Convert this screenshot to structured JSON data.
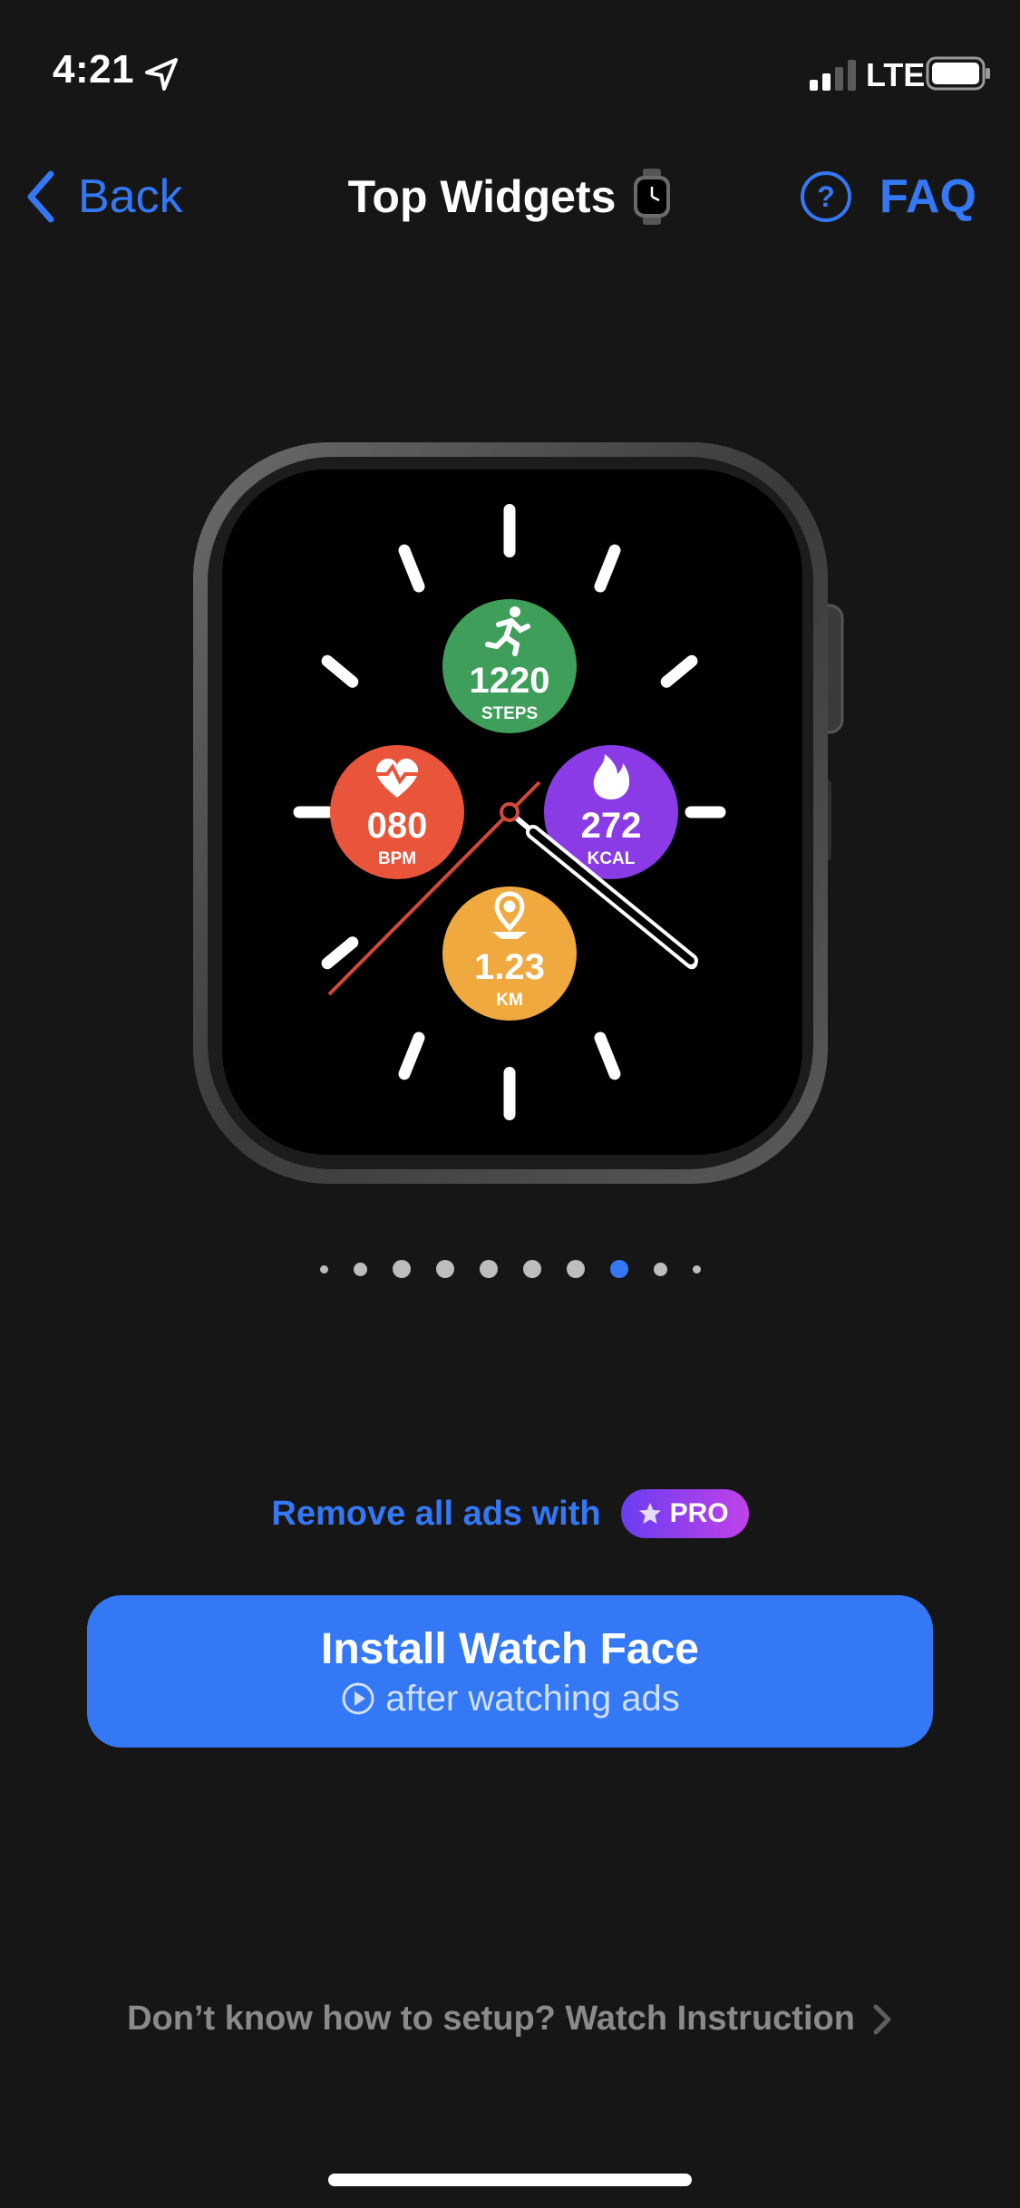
{
  "status_bar": {
    "time": "4:21",
    "network": "LTE"
  },
  "nav": {
    "back_label": "Back",
    "title": "Top Widgets",
    "faq_label": "FAQ"
  },
  "watch_face": {
    "steps": {
      "value": "1220",
      "unit": "STEPS",
      "color": "#3E9E5A"
    },
    "heart": {
      "value": "080",
      "unit": "BPM",
      "color": "#E8553A"
    },
    "calories": {
      "value": "272",
      "unit": "KCAL",
      "color": "#8B3BE6"
    },
    "distance": {
      "value": "1.23",
      "unit": "KM",
      "color": "#EFA93E"
    }
  },
  "pager": {
    "total": 10,
    "active_index": 7
  },
  "promo": {
    "text": "Remove all ads with",
    "badge": "PRO"
  },
  "install": {
    "title": "Install Watch Face",
    "subtitle": "after watching ads"
  },
  "help": {
    "text": "Don’t know how to setup? Watch Instruction"
  },
  "colors": {
    "accent": "#3478F6",
    "background": "#161616"
  }
}
